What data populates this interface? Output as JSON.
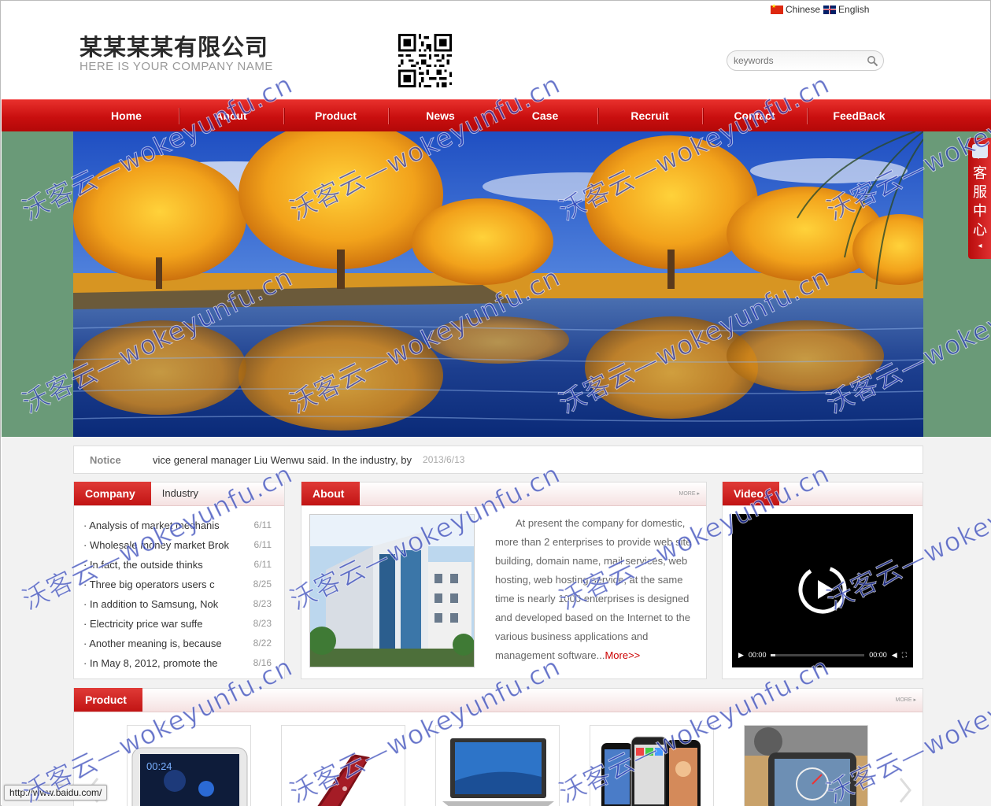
{
  "lang": {
    "chinese": "Chinese",
    "english": "English"
  },
  "logo": {
    "cn": "某某某某有限公司",
    "en": "HERE IS YOUR COMPANY NAME"
  },
  "search": {
    "placeholder": "keywords"
  },
  "nav": [
    "Home",
    "About",
    "Product",
    "News",
    "Case",
    "Recruit",
    "Contact",
    "FeedBack"
  ],
  "service": {
    "chars": [
      "客",
      "服",
      "中",
      "心"
    ]
  },
  "notice": {
    "label": "Notice",
    "text": "vice general manager Liu Wenwu said. In the industry, by",
    "date": "2013/6/13"
  },
  "company_panel": {
    "tab_active": "Company",
    "tab_other": "Industry",
    "items": [
      {
        "title": "· Analysis of market mechanis",
        "date": "6/11"
      },
      {
        "title": "· Wholesale money market Brok",
        "date": "6/11"
      },
      {
        "title": "· In fact, the outside thinks",
        "date": "6/11"
      },
      {
        "title": "· Three big operators users c",
        "date": "8/25"
      },
      {
        "title": "· In addition to Samsung, Nok",
        "date": "8/23"
      },
      {
        "title": "· Electricity price war suffe",
        "date": "8/23"
      },
      {
        "title": "· Another meaning is, because",
        "date": "8/22"
      },
      {
        "title": "· In May 8, 2012, promote the",
        "date": "8/16"
      }
    ]
  },
  "about_panel": {
    "title": "About",
    "more": "MORE ▸",
    "text": "At present the company for domestic, more than 2 enterprises to provide web site building, domain name, mail services, web hosting, web hosting service, at the same time is nearly 1000 enterprises is designed and developed based on the Internet to the various business applications and management software...",
    "more_link": "More>>"
  },
  "video_panel": {
    "title": "Video",
    "time_current": "00:00",
    "time_total": "00:00"
  },
  "product_panel": {
    "title": "Product",
    "more": "MORE ▸",
    "items": [
      "tablet",
      "laptop-red",
      "laptop",
      "smartphones",
      "gps-device"
    ]
  },
  "statusbar": {
    "url": "http://www.baidu.com/"
  },
  "watermark": {
    "text": "沃客云—wokeyunfu.cn"
  },
  "colors": {
    "nav_red": "#c90f0f",
    "banner_side": "#6a9a78",
    "watermark": "#2a3cb4"
  }
}
